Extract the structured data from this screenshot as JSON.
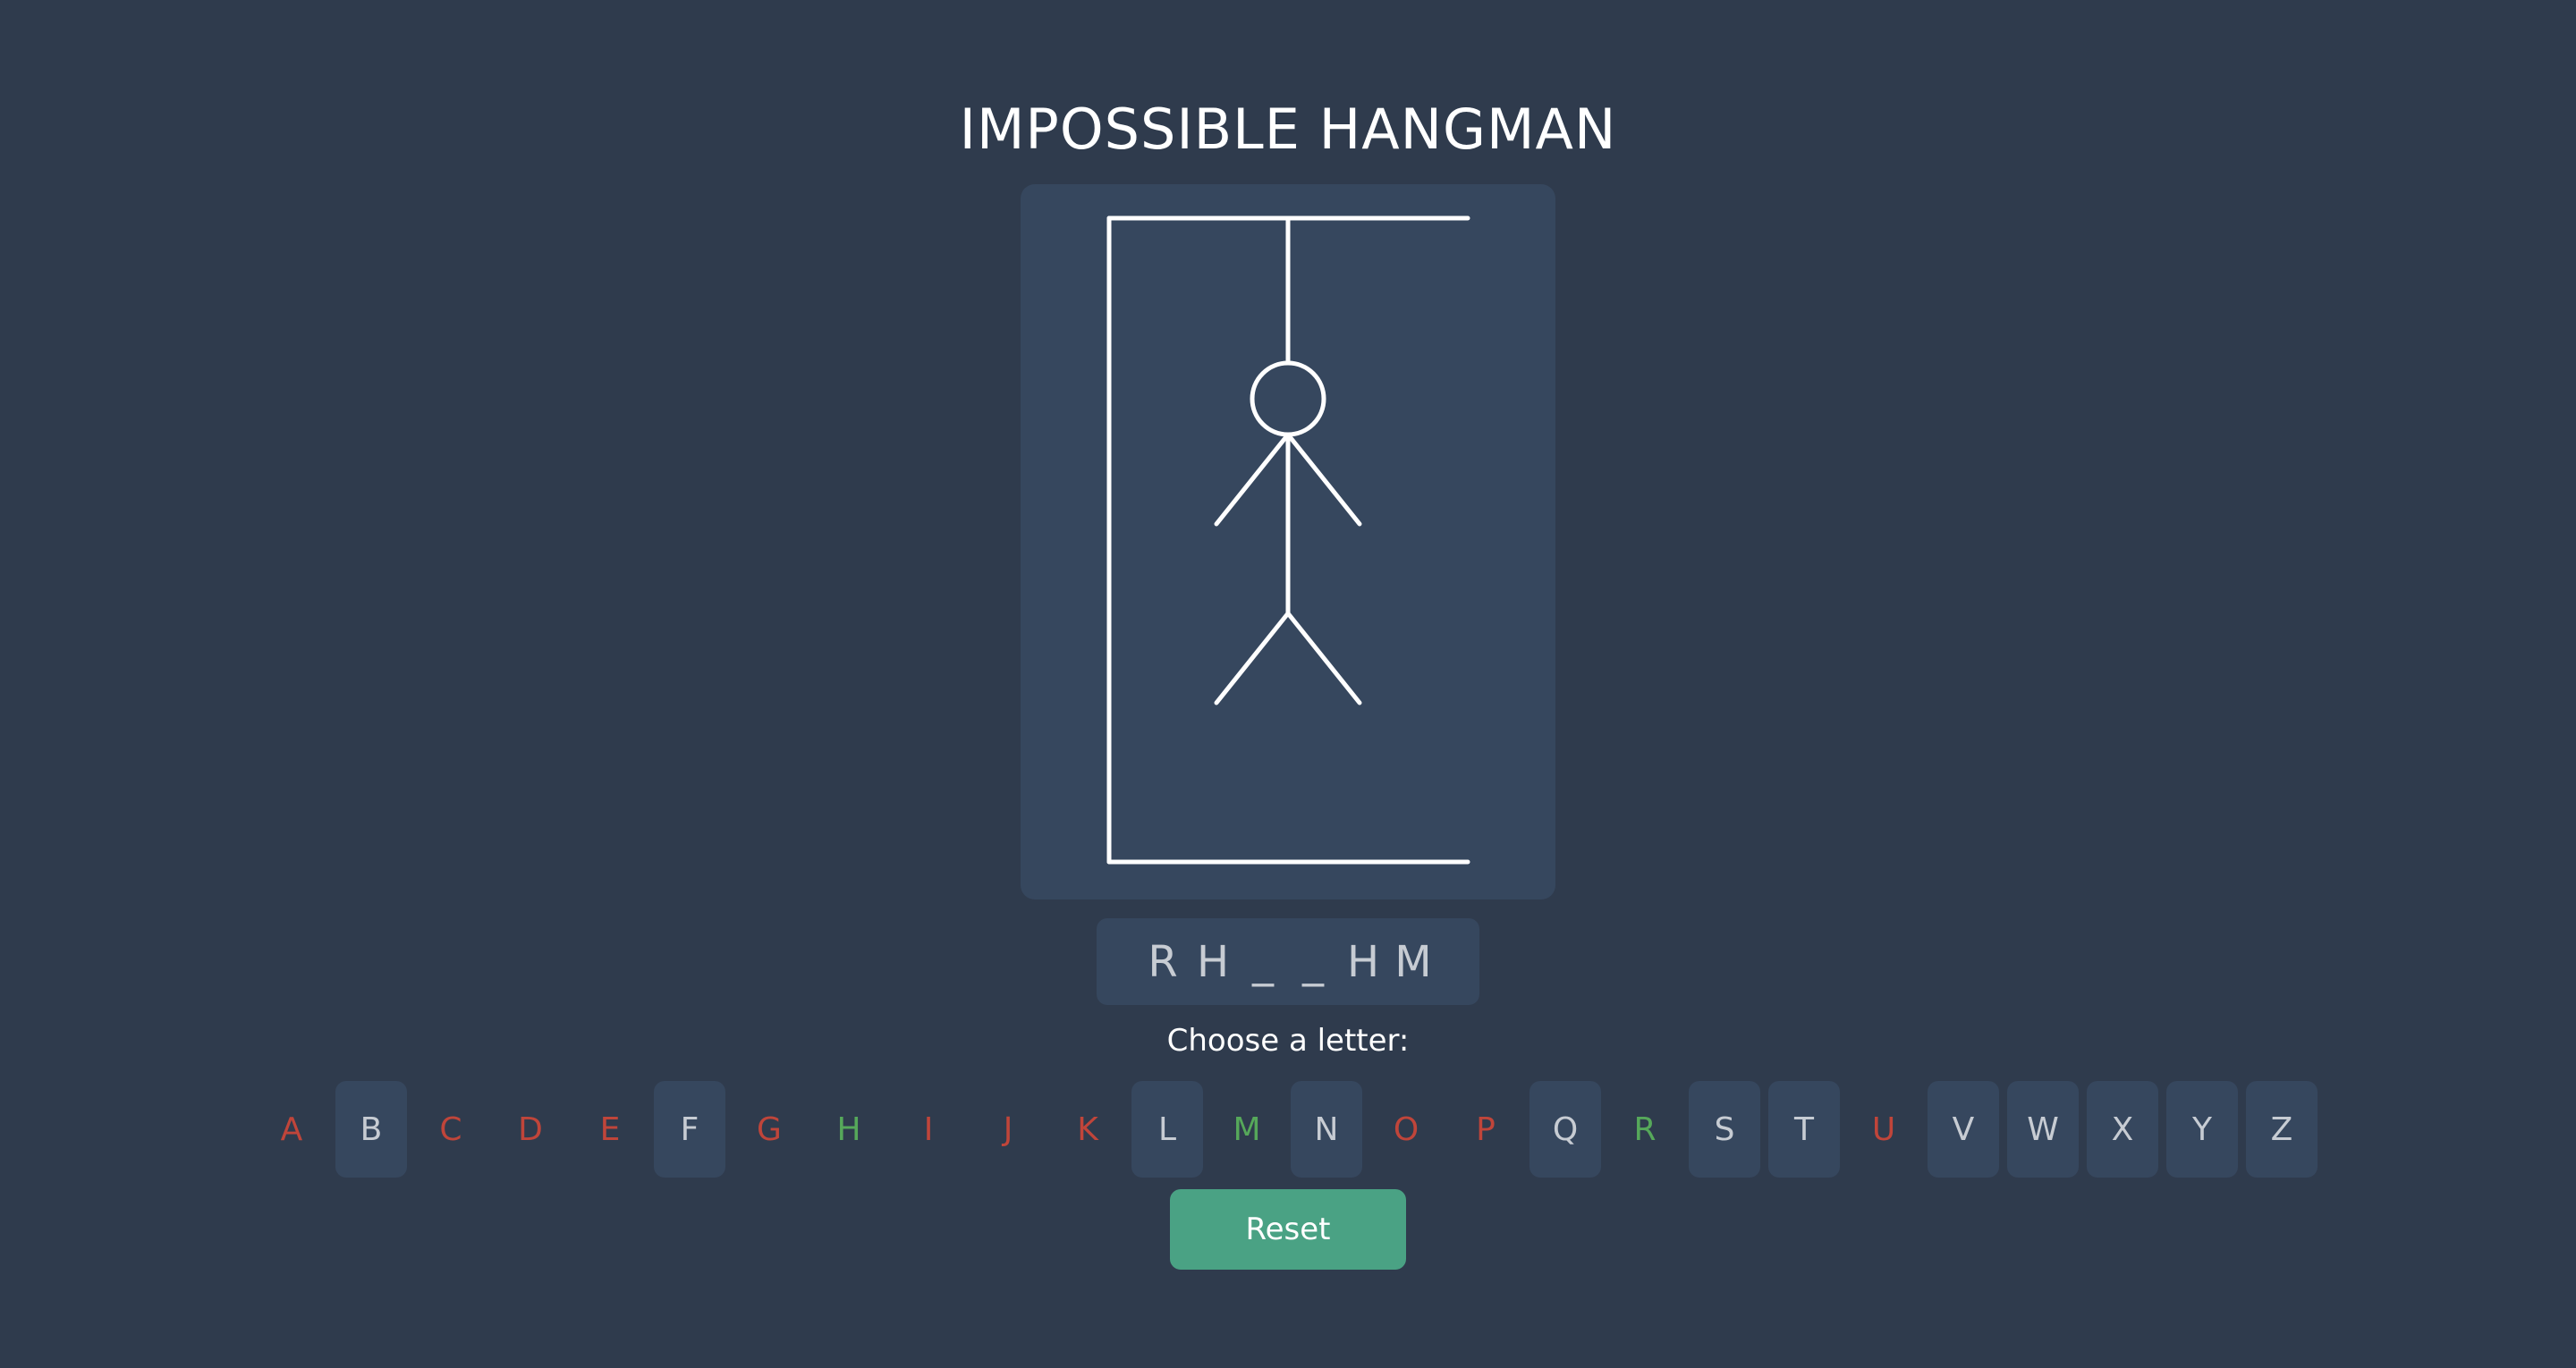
{
  "title": "IMPOSSIBLE HANGMAN",
  "word": [
    "R",
    "H",
    "_",
    "_",
    "H",
    "M"
  ],
  "prompt": "Choose a letter:",
  "letters": [
    {
      "char": "A",
      "state": "wrong"
    },
    {
      "char": "B",
      "state": "available"
    },
    {
      "char": "C",
      "state": "wrong"
    },
    {
      "char": "D",
      "state": "wrong"
    },
    {
      "char": "E",
      "state": "wrong"
    },
    {
      "char": "F",
      "state": "available"
    },
    {
      "char": "G",
      "state": "wrong"
    },
    {
      "char": "H",
      "state": "correct"
    },
    {
      "char": "I",
      "state": "wrong"
    },
    {
      "char": "J",
      "state": "wrong"
    },
    {
      "char": "K",
      "state": "wrong"
    },
    {
      "char": "L",
      "state": "available"
    },
    {
      "char": "M",
      "state": "correct"
    },
    {
      "char": "N",
      "state": "available"
    },
    {
      "char": "O",
      "state": "wrong"
    },
    {
      "char": "P",
      "state": "wrong"
    },
    {
      "char": "Q",
      "state": "available"
    },
    {
      "char": "R",
      "state": "correct"
    },
    {
      "char": "S",
      "state": "available"
    },
    {
      "char": "T",
      "state": "available"
    },
    {
      "char": "U",
      "state": "wrong"
    },
    {
      "char": "V",
      "state": "available"
    },
    {
      "char": "W",
      "state": "available"
    },
    {
      "char": "X",
      "state": "available"
    },
    {
      "char": "Y",
      "state": "available"
    },
    {
      "char": "Z",
      "state": "available"
    }
  ],
  "reset_label": "Reset",
  "colors": {
    "background": "#2f3b4d",
    "panel": "#36475e",
    "wrong": "#c0453a",
    "correct": "#56a85a",
    "reset": "#4aa284"
  }
}
